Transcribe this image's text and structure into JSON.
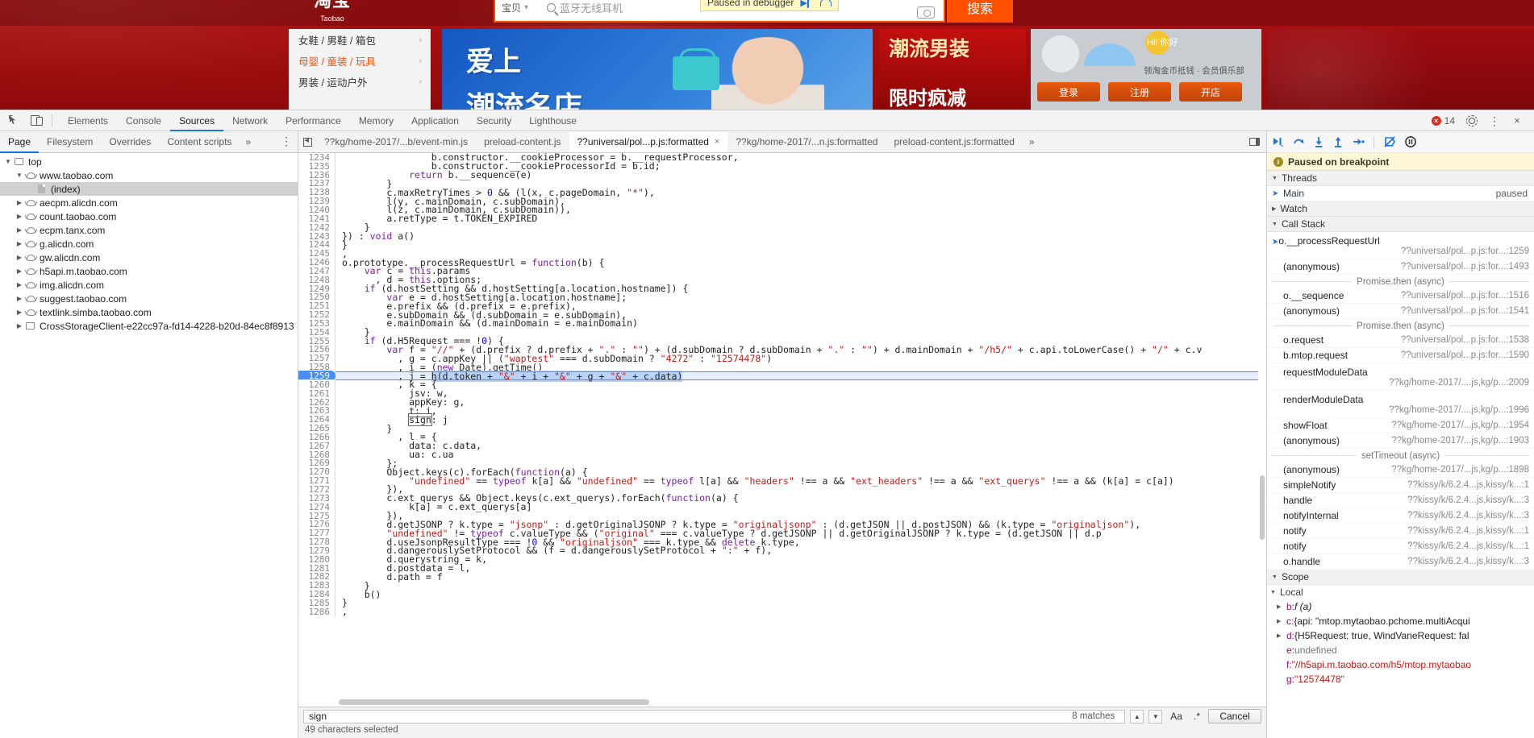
{
  "page": {
    "logo": {
      "title": "淘宝",
      "sub": "Taobao"
    },
    "search": {
      "category": "宝贝",
      "placeholder": "蓝牙无线耳机",
      "button": "搜索",
      "camera_icon": "camera-icon",
      "magnifier_icon": "search-icon"
    },
    "paused_badge": {
      "text": "Paused in debugger",
      "resume_icon": "resume-icon",
      "step-over-icon": "step-over-icon"
    },
    "categories": [
      {
        "label": "女鞋 / 男鞋 / 箱包",
        "hot": false
      },
      {
        "label": "母婴 / 童装 / 玩具",
        "hot": true
      },
      {
        "label": "男装 / 运动户外",
        "hot": false
      }
    ],
    "banner": {
      "line1": "爱上",
      "line2": "潮流名店"
    },
    "banner2": {
      "line1": "潮流男装",
      "line2": "限时疯减"
    },
    "right_card": {
      "greeting": "Hi! 你好",
      "links": "领淘金币抵钱  ·  会员俱乐部",
      "buttons": [
        "登录",
        "注册",
        "开店"
      ]
    }
  },
  "devtools": {
    "toolbar": {
      "inspect_icon": "inspect-element-icon",
      "device_icon": "device-toolbar-icon",
      "panels": [
        "Elements",
        "Console",
        "Sources",
        "Network",
        "Performance",
        "Memory",
        "Application",
        "Security",
        "Lighthouse"
      ],
      "selected_panel": "Sources",
      "overflow": "»",
      "error_count": "14",
      "error_icon": "error-badge-icon",
      "settings_icon": "gear-icon",
      "more_icon": "kebab-menu-icon",
      "close_icon": "close-icon",
      "accent": "#1a73e8"
    },
    "navigator": {
      "tabs": [
        "Page",
        "Filesystem",
        "Overrides",
        "Content scripts"
      ],
      "selected_tab": "Page",
      "overflow": "»",
      "more_icon": "kebab-menu-icon",
      "tree": [
        {
          "label": "top",
          "depth": 0,
          "twisty": "down",
          "icon": "frame-icon",
          "selected": false
        },
        {
          "label": "www.taobao.com",
          "depth": 1,
          "twisty": "down",
          "icon": "cloud-icon",
          "selected": false
        },
        {
          "label": "(index)",
          "depth": 2,
          "twisty": "none",
          "icon": "document-icon",
          "selected": true
        },
        {
          "label": "aecpm.alicdn.com",
          "depth": 1,
          "twisty": "right",
          "icon": "cloud-icon",
          "selected": false
        },
        {
          "label": "count.taobao.com",
          "depth": 1,
          "twisty": "right",
          "icon": "cloud-icon",
          "selected": false
        },
        {
          "label": "ecpm.tanx.com",
          "depth": 1,
          "twisty": "right",
          "icon": "cloud-icon",
          "selected": false
        },
        {
          "label": "g.alicdn.com",
          "depth": 1,
          "twisty": "right",
          "icon": "cloud-icon",
          "selected": false
        },
        {
          "label": "gw.alicdn.com",
          "depth": 1,
          "twisty": "right",
          "icon": "cloud-icon",
          "selected": false
        },
        {
          "label": "h5api.m.taobao.com",
          "depth": 1,
          "twisty": "right",
          "icon": "cloud-icon",
          "selected": false
        },
        {
          "label": "img.alicdn.com",
          "depth": 1,
          "twisty": "right",
          "icon": "cloud-icon",
          "selected": false
        },
        {
          "label": "suggest.taobao.com",
          "depth": 1,
          "twisty": "right",
          "icon": "cloud-icon",
          "selected": false
        },
        {
          "label": "textlink.simba.taobao.com",
          "depth": 1,
          "twisty": "right",
          "icon": "cloud-icon",
          "selected": false
        },
        {
          "label": "CrossStorageClient-e22cc97a-fd14-4228-b20d-84ec8f8913",
          "depth": 1,
          "twisty": "right",
          "icon": "frame-icon",
          "selected": false
        }
      ]
    },
    "file_tabs": {
      "back_icon": "navigate-back-icon",
      "tabs": [
        {
          "label": "??kg/home-2017/...b/event-min.js",
          "selected": false,
          "closable": false
        },
        {
          "label": "preload-content.js",
          "selected": false,
          "closable": false
        },
        {
          "label": "??universal/pol...p.js:formatted",
          "selected": true,
          "closable": true
        },
        {
          "label": "??kg/home-2017/...n.js:formatted",
          "selected": false,
          "closable": false
        },
        {
          "label": "preload-content.js:formatted",
          "selected": false,
          "closable": false
        }
      ],
      "overflow": "»",
      "dock_icon": "show-navigator-icon"
    },
    "code": {
      "highlighted_line": 1259,
      "first_line": 1234,
      "lines": [
        {
          "n": 1234,
          "text": "                b.constructor.__cookieProcessor = b.__requestProcessor,"
        },
        {
          "n": 1235,
          "text": "                b.constructor.__cookieProcessorId = b.id;"
        },
        {
          "n": 1236,
          "text": "            return b.__sequence(e)"
        },
        {
          "n": 1237,
          "text": "        }"
        },
        {
          "n": 1238,
          "text": "        c.maxRetryTimes > 0 && (l(x, c.pageDomain, \"*\"),"
        },
        {
          "n": 1239,
          "text": "        l(y, c.mainDomain, c.subDomain),"
        },
        {
          "n": 1240,
          "text": "        l(z, c.mainDomain, c.subDomain)),"
        },
        {
          "n": 1241,
          "text": "        a.retType = t.TOKEN_EXPIRED"
        },
        {
          "n": 1242,
          "text": "    }"
        },
        {
          "n": 1243,
          "text": "}) : void a()"
        },
        {
          "n": 1244,
          "text": "}"
        },
        {
          "n": 1245,
          "text": ","
        },
        {
          "n": 1246,
          "text": "o.prototype.__processRequestUrl = function(b) {"
        },
        {
          "n": 1247,
          "text": "    var c = this.params"
        },
        {
          "n": 1248,
          "text": "      , d = this.options;"
        },
        {
          "n": 1249,
          "text": "    if (d.hostSetting && d.hostSetting[a.location.hostname]) {"
        },
        {
          "n": 1250,
          "text": "        var e = d.hostSetting[a.location.hostname];"
        },
        {
          "n": 1251,
          "text": "        e.prefix && (d.prefix = e.prefix),"
        },
        {
          "n": 1252,
          "text": "        e.subDomain && (d.subDomain = e.subDomain),"
        },
        {
          "n": 1253,
          "text": "        e.mainDomain && (d.mainDomain = e.mainDomain)"
        },
        {
          "n": 1254,
          "text": "    }"
        },
        {
          "n": 1255,
          "text": "    if (d.H5Request === !0) {"
        },
        {
          "n": 1256,
          "text": "        var f = \"//\" + (d.prefix ? d.prefix + \".\" : \"\") + (d.subDomain ? d.subDomain + \".\" : \"\") + d.mainDomain + \"/h5/\" + c.api.toLowerCase() + \"/\" + c.v"
        },
        {
          "n": 1257,
          "text": "          , g = c.appKey || (\"waptest\" === d.subDomain ? \"4272\" : \"12574478\")"
        },
        {
          "n": 1258,
          "text": "          , i = (new Date).getTime()"
        },
        {
          "n": 1259,
          "text": "          , j = h(d.token + \"&\" + i + \"&\" + g + \"&\" + c.data)"
        },
        {
          "n": 1260,
          "text": "          , k = {"
        },
        {
          "n": 1261,
          "text": "            jsv: w,"
        },
        {
          "n": 1262,
          "text": "            appKey: g,"
        },
        {
          "n": 1263,
          "text": "            t: i,"
        },
        {
          "n": 1264,
          "text": "            sign: j"
        },
        {
          "n": 1265,
          "text": "        }"
        },
        {
          "n": 1266,
          "text": "          , l = {"
        },
        {
          "n": 1267,
          "text": "            data: c.data,"
        },
        {
          "n": 1268,
          "text": "            ua: c.ua"
        },
        {
          "n": 1269,
          "text": "        };"
        },
        {
          "n": 1270,
          "text": "        Object.keys(c).forEach(function(a) {"
        },
        {
          "n": 1271,
          "text": "            \"undefined\" == typeof k[a] && \"undefined\" == typeof l[a] && \"headers\" !== a && \"ext_headers\" !== a && \"ext_querys\" !== a && (k[a] = c[a])"
        },
        {
          "n": 1272,
          "text": "        }),"
        },
        {
          "n": 1273,
          "text": "        c.ext_querys && Object.keys(c.ext_querys).forEach(function(a) {"
        },
        {
          "n": 1274,
          "text": "            k[a] = c.ext_querys[a]"
        },
        {
          "n": 1275,
          "text": "        }),"
        },
        {
          "n": 1276,
          "text": "        d.getJSONP ? k.type = \"jsonp\" : d.getOriginalJSONP ? k.type = \"originaljsonp\" : (d.getJSON || d.postJSON) && (k.type = \"originaljson\"),"
        },
        {
          "n": 1277,
          "text": "        \"undefined\" != typeof c.valueType && (\"original\" === c.valueType ? d.getJSONP || d.getOriginalJSONP ? k.type = (d.getJSON || d.p"
        },
        {
          "n": 1278,
          "text": "        d.useJsonpResultType === !0 && \"originaljson\" === k.type && delete k.type,"
        },
        {
          "n": 1279,
          "text": "        d.dangerouslySetProtocol && (f = d.dangerouslySetProtocol + \":\" + f),"
        },
        {
          "n": 1280,
          "text": "        d.querystring = k,"
        },
        {
          "n": 1281,
          "text": "        d.postdata = l,"
        },
        {
          "n": 1282,
          "text": "        d.path = f"
        },
        {
          "n": 1283,
          "text": "    }"
        },
        {
          "n": 1284,
          "text": "    b()"
        },
        {
          "n": 1285,
          "text": "}"
        },
        {
          "n": 1286,
          "text": ","
        }
      ]
    },
    "find_bar": {
      "query": "sign",
      "matches": "8 matches",
      "prev_icon": "chevron-up-icon",
      "next_icon": "chevron-down-icon",
      "match_case_label": "Aa",
      "regex_label": ".*",
      "cancel_label": "Cancel",
      "status": "49 characters selected"
    },
    "debugger": {
      "toolbar": {
        "resume_icon": "resume-script-icon",
        "step_over_icon": "step-over-icon",
        "step_into_icon": "step-into-icon",
        "step_out_icon": "step-out-icon",
        "step_icon": "step-icon",
        "deactivate_breakpoints_icon": "deactivate-breakpoints-icon",
        "pause_on_exceptions_icon": "pause-on-exceptions-icon"
      },
      "paused_message": "Paused on breakpoint",
      "threads": {
        "title": "Threads",
        "items": [
          {
            "name": "Main",
            "state": "paused"
          }
        ]
      },
      "watch": {
        "title": "Watch"
      },
      "call_stack": {
        "title": "Call Stack",
        "frames": [
          {
            "name": "o.__processRequestUrl",
            "location": "??universal/pol...p.js:for...:1259",
            "active": true,
            "wrapped": true
          },
          {
            "name": "(anonymous)",
            "location": "??universal/pol...p.js:for...:1493",
            "active": false,
            "wrapped": false
          },
          {
            "async": "Promise.then (async)"
          },
          {
            "name": "o.__sequence",
            "location": "??universal/pol...p.js:for...:1516",
            "active": false,
            "wrapped": false
          },
          {
            "name": "(anonymous)",
            "location": "??universal/pol...p.js:for...:1541",
            "active": false,
            "wrapped": false
          },
          {
            "async": "Promise.then (async)"
          },
          {
            "name": "o.request",
            "location": "??universal/pol...p.js:for...:1538",
            "active": false,
            "wrapped": false
          },
          {
            "name": "b.mtop.request",
            "location": "??universal/pol...p.js:for...:1590",
            "active": false,
            "wrapped": false
          },
          {
            "name": "requestModuleData",
            "location": "??kg/home-2017/....js,kg/p...:2009",
            "active": false,
            "wrapped": true
          },
          {
            "name": "renderModuleData",
            "location": "??kg/home-2017/....js,kg/p...:1996",
            "active": false,
            "wrapped": true
          },
          {
            "name": "showFloat",
            "location": "??kg/home-2017/...js,kg/p...:1954",
            "active": false,
            "wrapped": false
          },
          {
            "name": "(anonymous)",
            "location": "??kg/home-2017/...js,kg/p...:1903",
            "active": false,
            "wrapped": false
          },
          {
            "async": "setTimeout (async)"
          },
          {
            "name": "(anonymous)",
            "location": "??kg/home-2017/...js,kg/p...:1898",
            "active": false,
            "wrapped": false
          },
          {
            "name": "simpleNotify",
            "location": "??kissy/k/6.2.4...js,kissy/k...:1",
            "active": false,
            "wrapped": false
          },
          {
            "name": "handle",
            "location": "??kissy/k/6.2.4...js,kissy/k...:3",
            "active": false,
            "wrapped": false
          },
          {
            "name": "notifyInternal",
            "location": "??kissy/k/6.2.4...js,kissy/k...:3",
            "active": false,
            "wrapped": false
          },
          {
            "name": "notify",
            "location": "??kissy/k/6.2.4...js,kissy/k...:1",
            "active": false,
            "wrapped": false
          },
          {
            "name": "notify",
            "location": "??kissy/k/6.2.4...js,kissy/k...:1",
            "active": false,
            "wrapped": false
          },
          {
            "name": "o.handle",
            "location": "??kissy/k/6.2.4...js,kissy/k...:3",
            "active": false,
            "wrapped": false
          }
        ]
      },
      "scope": {
        "title": "Scope",
        "sections": [
          {
            "title": "Local"
          }
        ],
        "vars": [
          {
            "twisty": "right",
            "name": "b:",
            "value": "f (a)",
            "kind": "fn"
          },
          {
            "twisty": "right",
            "name": "c:",
            "value": "{api: \"mtop.mytaobao.pchome.multiAcqui",
            "kind": "obj"
          },
          {
            "twisty": "right",
            "name": "d:",
            "value": "{H5Request: true, WindVaneRequest: fal",
            "kind": "obj"
          },
          {
            "twisty": "none",
            "name": "e:",
            "value": "undefined",
            "kind": "grey"
          },
          {
            "twisty": "none",
            "name": "f:",
            "value": "\"//h5api.m.taobao.com/h5/mtop.mytaobao",
            "kind": "str"
          },
          {
            "twisty": "none",
            "name": "g:",
            "value": "\"12574478\"",
            "kind": "str"
          }
        ]
      }
    }
  }
}
